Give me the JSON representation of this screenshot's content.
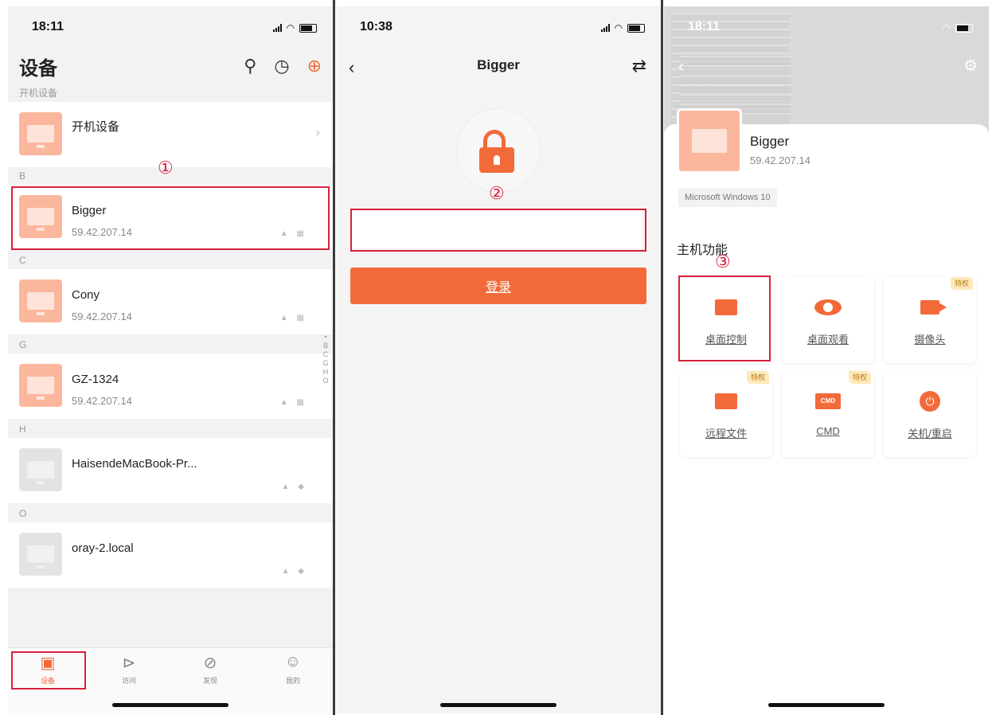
{
  "panel1": {
    "status_time": "18:11",
    "title": "设备",
    "header_icons": [
      "search-icon",
      "history-icon",
      "add-icon"
    ],
    "boot_section_label": "开机设备",
    "boot_item_label": "开机设备",
    "sections": [
      {
        "letter": "B",
        "name": "Bigger",
        "ip": "59.42.207.14",
        "online": true
      },
      {
        "letter": "C",
        "name": "Cony",
        "ip": "59.42.207.14",
        "online": true
      },
      {
        "letter": "G",
        "name": "GZ-1324",
        "ip": "59.42.207.14",
        "online": true
      },
      {
        "letter": "H",
        "name": "HaisendeMacBook-Pr...",
        "ip": "",
        "online": false
      },
      {
        "letter": "O",
        "name": "oray-2.local",
        "ip": "",
        "online": false
      }
    ],
    "alpha_index": [
      "•",
      "B",
      "C",
      "G",
      "H",
      "O"
    ],
    "tabs": [
      {
        "label": "设备",
        "icon": "devices-icon",
        "active": true
      },
      {
        "label": "访问",
        "icon": "visit-icon",
        "active": false
      },
      {
        "label": "发现",
        "icon": "compass-icon",
        "active": false
      },
      {
        "label": "我的",
        "icon": "profile-icon",
        "active": false
      }
    ],
    "step_marker": "①"
  },
  "panel2": {
    "status_time": "10:38",
    "title": "Bigger",
    "password_value": "",
    "login_label": "登录",
    "step_marker": "②"
  },
  "panel3": {
    "status_time": "18:11",
    "device_name": "Bigger",
    "device_ip": "59.42.207.14",
    "os": "Microsoft Windows 10",
    "section_title": "主机功能",
    "step_marker": "③",
    "functions": [
      {
        "label": "桌面控制",
        "icon": "desktop-control-icon",
        "badge": ""
      },
      {
        "label": "桌面观看",
        "icon": "eye-icon",
        "badge": ""
      },
      {
        "label": "摄像头",
        "icon": "camera-icon",
        "badge": "特权"
      },
      {
        "label": "远程文件",
        "icon": "folder-icon",
        "badge": "特权"
      },
      {
        "label": "CMD",
        "icon": "cmd-icon",
        "badge": "特权"
      },
      {
        "label": "关机/重启",
        "icon": "power-icon",
        "badge": ""
      }
    ],
    "cmd_icon_text": "CMD"
  },
  "colors": {
    "accent": "#f36a3a",
    "highlight": "#d81f3c",
    "thumb": "#fbb79d",
    "badge_bg": "#fde9b8"
  }
}
